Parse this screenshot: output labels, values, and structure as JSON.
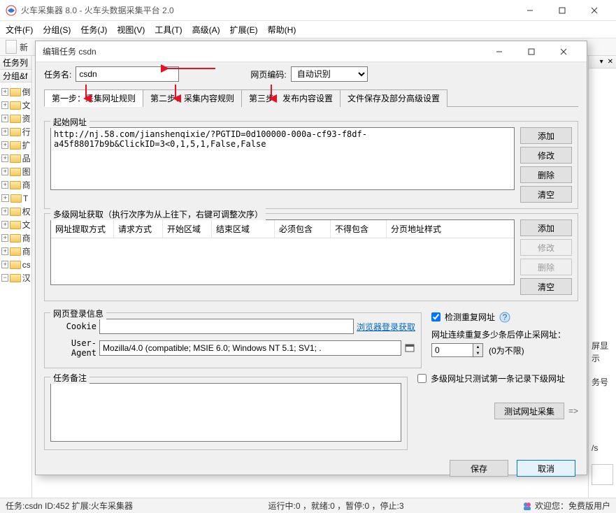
{
  "app": {
    "title": "火车采集器 8.0 - 火车头数据采集平台 2.0",
    "menus": [
      "文件(F)",
      "分组(S)",
      "任务(J)",
      "视图(V)",
      "工具(T)",
      "高级(A)",
      "扩展(E)",
      "帮助(H)"
    ],
    "new_doc": "新"
  },
  "sidebar": {
    "tab_title": "任务列",
    "group_label": "分组&f",
    "nodes": [
      "倒",
      "文",
      "资",
      "行",
      "扩",
      "品",
      "图",
      "商",
      "T",
      "权",
      "文",
      "商",
      "商",
      "cs",
      "汉"
    ]
  },
  "rightdock": {
    "mode_label": "屏显示",
    "acct_label": "务号",
    "speed_unit": "/s"
  },
  "status": {
    "task": "任务:csdn  ID:452  扩展:火车采集器",
    "running": "运行中:0 ，就绪:0 ，暂停:0 ，停止:3",
    "welcome": "欢迎您：免费版用户"
  },
  "dialog": {
    "title": "编辑任务 csdn",
    "taskname_label": "任务名:",
    "taskname_value": "csdn",
    "encoding_label": "网页编码:",
    "encoding_value": "自动识别",
    "tabs": [
      "第一步：采集网址规则",
      "第二步：采集内容规则",
      "第三步：发布内容设置",
      "文件保存及部分高级设置"
    ],
    "start_url_legend": "起始网址",
    "start_url_list": "http://nj.58.com/jianshenqixie/?PGTID=0d100000-000a-cf93-f8df-a45f88017b9b&ClickID=3<0,1,5,1,False,False",
    "btns_url": {
      "add": "添加",
      "mod": "修改",
      "del": "删除",
      "clr": "清空"
    },
    "multi_legend": "多级网址获取（执行次序为从上往下，右键可调整次序）",
    "grid_cols": [
      "网址提取方式",
      "请求方式",
      "开始区域",
      "结束区域",
      "必须包含",
      "不得包含",
      "分页地址样式"
    ],
    "login_legend": "网页登录信息",
    "cookie_label": "Cookie",
    "cookie_value": "",
    "browser_login": "浏览器登录获取",
    "ua_label": "User-Agent",
    "ua_value": "Mozilla/4.0 (compatible; MSIE 6.0; Windows NT 5.1; SV1; .",
    "detect_dup": "检测重复网址",
    "stop_label": "网址连续重复多少条后停止采网址：",
    "stop_value": "0",
    "stop_hint": "(0为不限)",
    "remark_legend": "任务备注",
    "remark_value": "",
    "multi_only": "多级网址只测试第一条记录下级网址",
    "test_btn": "测试网址采集",
    "arrow": "=>",
    "save": "保存",
    "cancel": "取消"
  }
}
